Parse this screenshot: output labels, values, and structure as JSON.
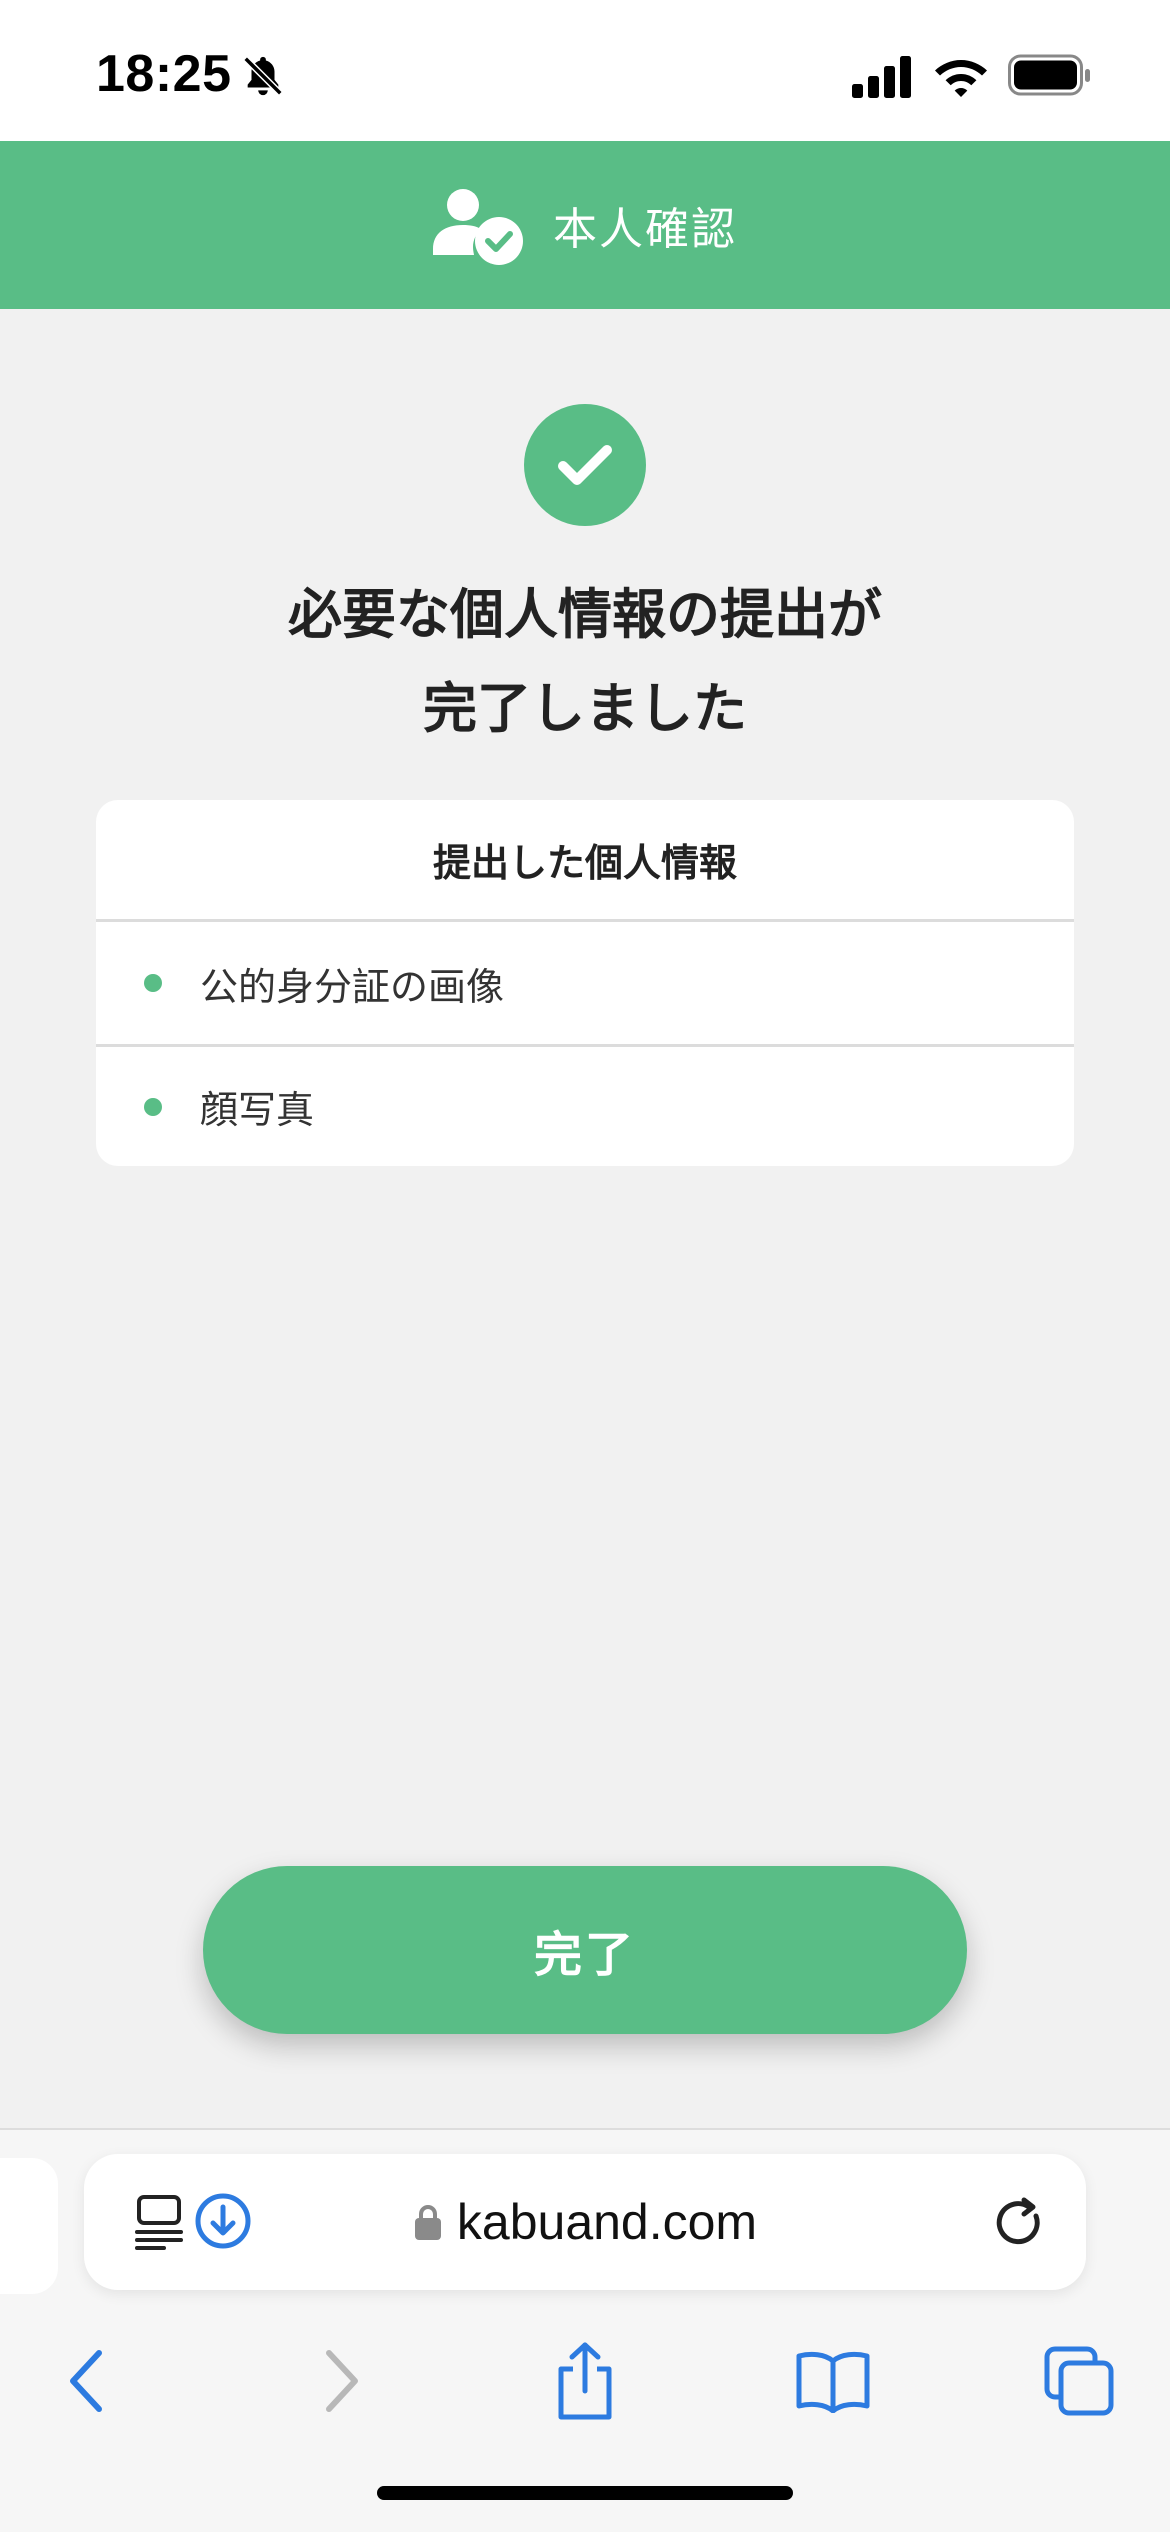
{
  "status_bar": {
    "time": "18:25",
    "icons": [
      "bell-off-icon",
      "cellular-signal-icon",
      "wifi-icon",
      "battery-icon"
    ]
  },
  "header": {
    "icon": "user-check-icon",
    "title": "本人確認",
    "background": "#59bd86"
  },
  "main": {
    "status_icon": "check-circle-icon",
    "title_line1": "必要な個人情報の提出が",
    "title_line2": "完了しました",
    "card": {
      "heading": "提出した個人情報",
      "items": [
        {
          "label": "公的身分証の画像"
        },
        {
          "label": "顔写真"
        }
      ]
    },
    "done_button": "完了"
  },
  "browser": {
    "url": "kabuand.com",
    "icons": [
      "reader-icon",
      "download-icon",
      "lock-icon",
      "reload-icon"
    ],
    "toolbar": [
      "back-icon",
      "forward-icon",
      "share-icon",
      "bookmarks-icon",
      "tabs-icon"
    ],
    "accent": "#2d7be0"
  }
}
